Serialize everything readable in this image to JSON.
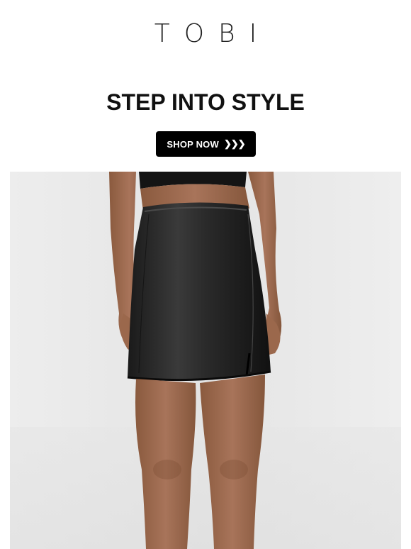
{
  "brand": {
    "logo_text": "TOBI"
  },
  "hero": {
    "headline": "STEP INTO STYLE",
    "cta_label": "SHOP NOW",
    "cta_icon": "triple-chevron-right-icon",
    "image_subject": "model-leather-mini-skirt-photo"
  },
  "colors": {
    "background": "#ffffff",
    "cta_background": "#000000",
    "cta_text": "#ffffff",
    "headline": "#111111",
    "photo_backdrop": "#e9e9e9"
  }
}
